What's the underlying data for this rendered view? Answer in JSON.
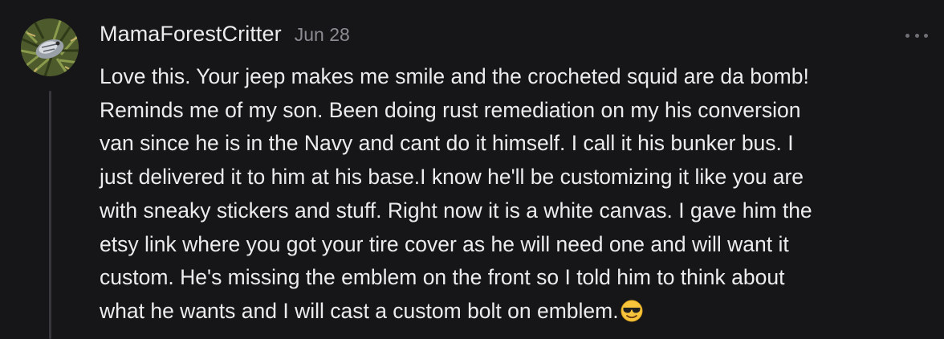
{
  "comment": {
    "author": "MamaForestCritter",
    "date": "Jun 28",
    "avatar_icon": "forest-critter-avatar",
    "more_icon": "more-horizontal-icon",
    "body_lines": [
      "Love this. Your jeep makes me smile and the crocheted squid are da bomb!",
      "Reminds me of my son. Been doing rust remediation on my his conversion",
      "van since he is in the Navy and cant do it himself. I call it his bunker bus. I",
      "just delivered it to him at his base.I know he'll be customizing it like you are",
      "with sneaky stickers and stuff. Right now it is a white canvas. I gave him the",
      "etsy link where you got your tire cover as he will need one and will want it",
      "custom. He's missing the emblem on the front so I told him to think about",
      "what he wants and I will cast a custom bolt on emblem."
    ],
    "trailing_emoji": "smiling-face-with-sunglasses-icon"
  }
}
